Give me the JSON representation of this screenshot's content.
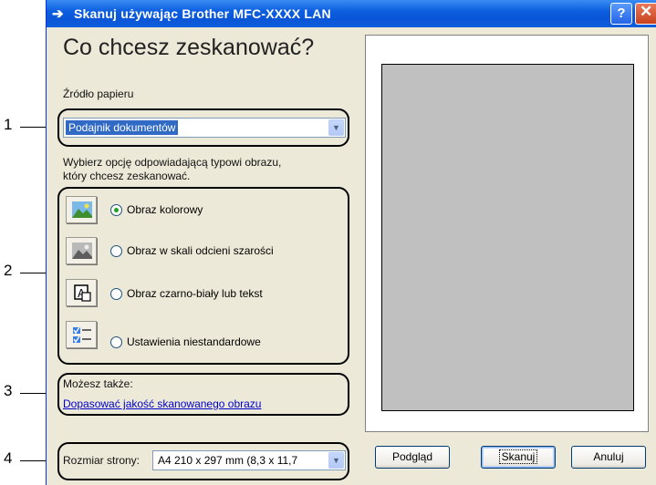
{
  "window": {
    "title": "Skanuj używając Brother MFC-XXXX  LAN",
    "help_label": "?"
  },
  "heading": "Co chcesz zeskanować?",
  "paper_source": {
    "label": "Źródło papieru",
    "value": "Podajnik dokumentów"
  },
  "instructions": {
    "line1": "Wybierz opcję odpowiadającą typowi obrazu,",
    "line2": "który chcesz zeskanować."
  },
  "image_types": [
    {
      "label": "Obraz kolorowy",
      "selected": true,
      "icon": "color-image-icon"
    },
    {
      "label": "Obraz w skali odcieni szarości",
      "selected": false,
      "icon": "grayscale-image-icon"
    },
    {
      "label": "Obraz czarno-biały lub tekst",
      "selected": false,
      "icon": "bw-text-icon"
    },
    {
      "label": "Ustawienia niestandardowe",
      "selected": false,
      "icon": "custom-settings-icon"
    }
  ],
  "also": {
    "label": "Możesz także:",
    "link": "Dopasować jakość skanowanego obrazu"
  },
  "page_size": {
    "label": "Rozmiar strony:",
    "value": "A4 210 x 297 mm (8,3 x 11,7"
  },
  "buttons": {
    "preview": "Podgląd",
    "scan": "Skanuj",
    "cancel": "Anuluj"
  },
  "callouts": [
    "1",
    "2",
    "3",
    "4"
  ],
  "colors": {
    "titlebar": "#0a55d7",
    "dialog_bg": "#ece9d8",
    "selection": "#316ac5",
    "preview_page": "#c0c0c0",
    "link": "#0000cc"
  }
}
